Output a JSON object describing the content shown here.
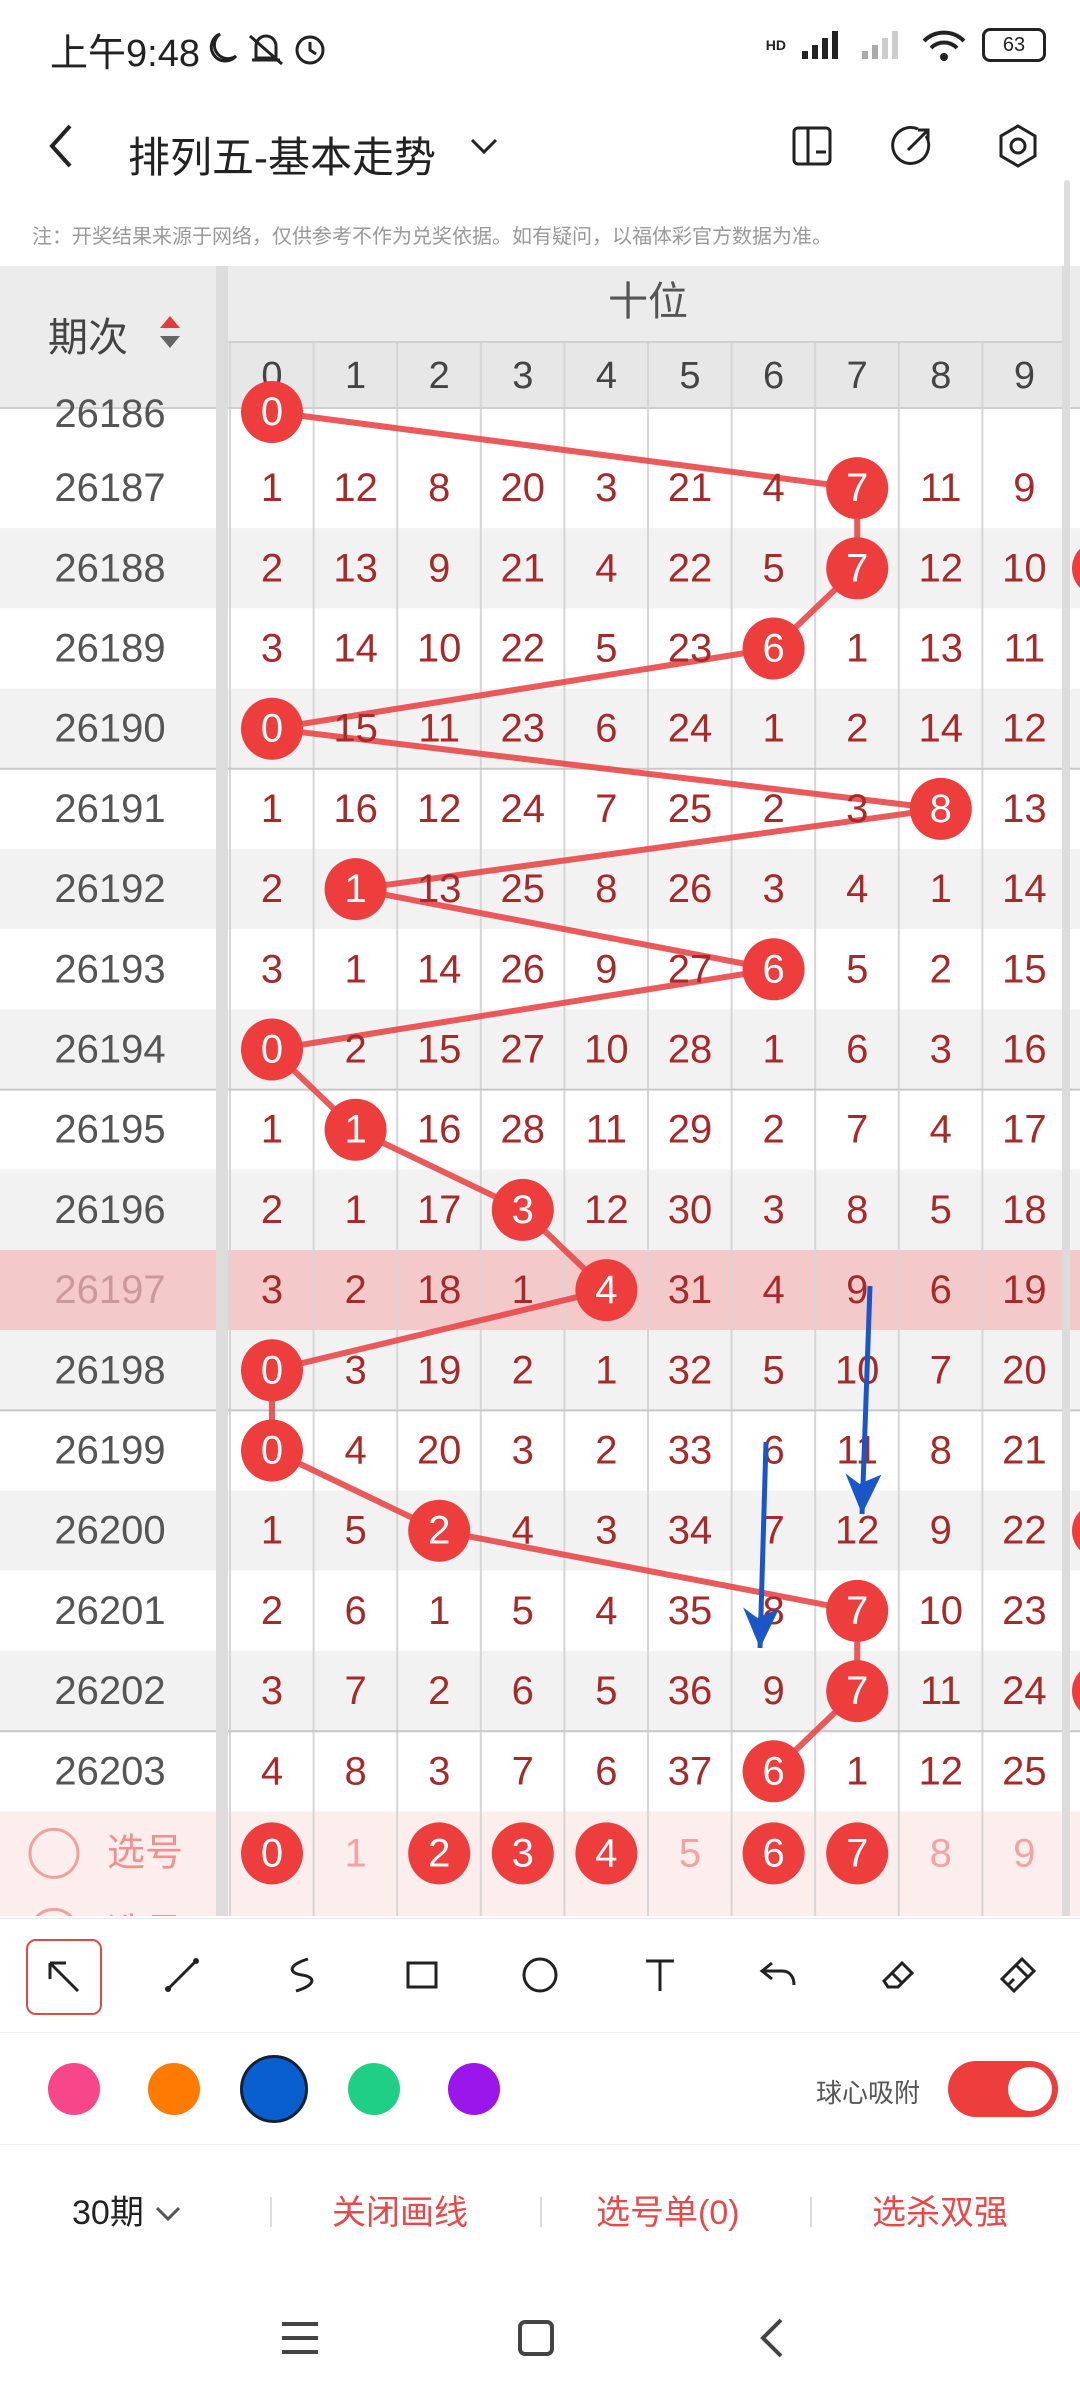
{
  "status": {
    "time": "上午9:48",
    "battery": "63",
    "network": "HD"
  },
  "header": {
    "title": "排列五-基本走势"
  },
  "notice": "注：开奖结果来源于网络，仅供参考不作为兑奖依据。如有疑问，以福体彩官方数据为准。",
  "table": {
    "period_header": "期次",
    "group_header": "十位",
    "digit_headers": [
      "0",
      "1",
      "2",
      "3",
      "4",
      "5",
      "6",
      "7",
      "8",
      "9"
    ],
    "partial_top_period": "26186",
    "rows": [
      {
        "period": "26187",
        "cells": [
          "1",
          "12",
          "8",
          "20",
          "3",
          "21",
          "4",
          "7",
          "11",
          "9"
        ],
        "hit": 7
      },
      {
        "period": "26188",
        "cells": [
          "2",
          "13",
          "9",
          "21",
          "4",
          "22",
          "5",
          "7",
          "12",
          "10"
        ],
        "hit": 7
      },
      {
        "period": "26189",
        "cells": [
          "3",
          "14",
          "10",
          "22",
          "5",
          "23",
          "6",
          "1",
          "13",
          "11"
        ],
        "hit": 6
      },
      {
        "period": "26190",
        "cells": [
          "0",
          "15",
          "11",
          "23",
          "6",
          "24",
          "1",
          "2",
          "14",
          "12"
        ],
        "hit": 0
      },
      {
        "period": "26191",
        "cells": [
          "1",
          "16",
          "12",
          "24",
          "7",
          "25",
          "2",
          "3",
          "8",
          "13"
        ],
        "hit": 8
      },
      {
        "period": "26192",
        "cells": [
          "2",
          "1",
          "13",
          "25",
          "8",
          "26",
          "3",
          "4",
          "1",
          "14"
        ],
        "hit": 1
      },
      {
        "period": "26193",
        "cells": [
          "3",
          "1",
          "14",
          "26",
          "9",
          "27",
          "6",
          "5",
          "2",
          "15"
        ],
        "hit": 6
      },
      {
        "period": "26194",
        "cells": [
          "0",
          "2",
          "15",
          "27",
          "10",
          "28",
          "1",
          "6",
          "3",
          "16"
        ],
        "hit": 0
      },
      {
        "period": "26195",
        "cells": [
          "1",
          "1",
          "16",
          "28",
          "11",
          "29",
          "2",
          "7",
          "4",
          "17"
        ],
        "hit": 1
      },
      {
        "period": "26196",
        "cells": [
          "2",
          "1",
          "17",
          "3",
          "12",
          "30",
          "3",
          "8",
          "5",
          "18"
        ],
        "hit": 3
      },
      {
        "period": "26197",
        "cells": [
          "3",
          "2",
          "18",
          "1",
          "4",
          "31",
          "4",
          "9",
          "6",
          "19"
        ],
        "hit": 4
      },
      {
        "period": "26198",
        "cells": [
          "0",
          "3",
          "19",
          "2",
          "1",
          "32",
          "5",
          "10",
          "7",
          "20"
        ],
        "hit": 0
      },
      {
        "period": "26199",
        "cells": [
          "0",
          "4",
          "20",
          "3",
          "2",
          "33",
          "6",
          "11",
          "8",
          "21"
        ],
        "hit": 0
      },
      {
        "period": "26200",
        "cells": [
          "1",
          "5",
          "2",
          "4",
          "3",
          "34",
          "7",
          "12",
          "9",
          "22"
        ],
        "hit": 2
      },
      {
        "period": "26201",
        "cells": [
          "2",
          "6",
          "1",
          "5",
          "4",
          "35",
          "8",
          "7",
          "10",
          "23"
        ],
        "hit": 7
      },
      {
        "period": "26202",
        "cells": [
          "3",
          "7",
          "2",
          "6",
          "5",
          "36",
          "9",
          "7",
          "11",
          "24"
        ],
        "hit": 7
      },
      {
        "period": "26203",
        "cells": [
          "4",
          "8",
          "3",
          "7",
          "6",
          "37",
          "6",
          "1",
          "12",
          "25"
        ],
        "hit": 6
      }
    ],
    "pick_row": {
      "label": "选号",
      "label2": "选号",
      "balls": [
        "0",
        "1",
        "2",
        "3",
        "4",
        "5",
        "6",
        "7",
        "8",
        "9"
      ],
      "selected": [
        true,
        false,
        true,
        true,
        true,
        false,
        true,
        true,
        false,
        false
      ]
    }
  },
  "tools": [
    "arrow-tool",
    "line-tool",
    "curve-tool",
    "rectangle-tool",
    "circle-tool",
    "text-tool",
    "undo",
    "eraser",
    "clear"
  ],
  "colors": {
    "swatches": [
      "#f7478a",
      "#ff7a00",
      "#0a5fd0",
      "#1fcf86",
      "#9b16ea"
    ],
    "selected_index": 2,
    "accent": "#e84848",
    "annotation_blue": "#1a56c8"
  },
  "snap": {
    "label": "球心吸附",
    "enabled": true
  },
  "bottom": {
    "periods": "30期",
    "close_lines": "关闭画线",
    "pick_list": "选号单(0)",
    "double": "选杀双强"
  }
}
